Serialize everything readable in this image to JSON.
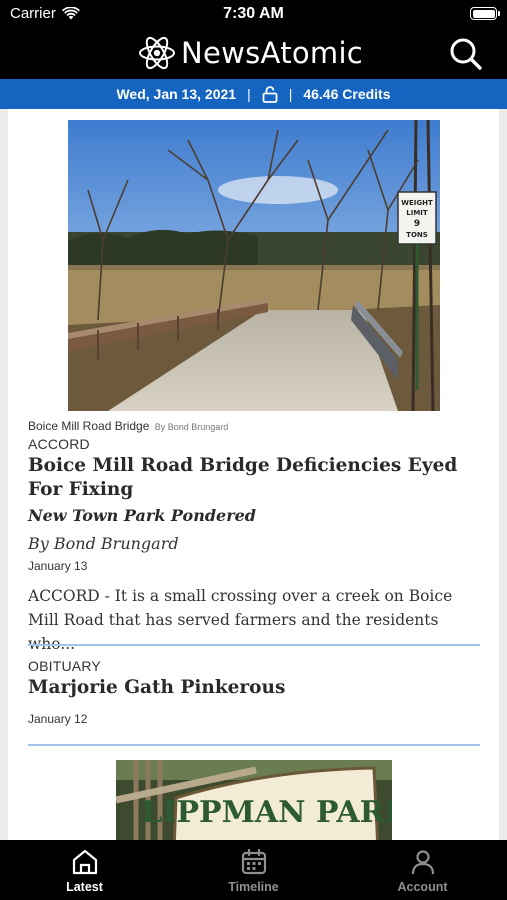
{
  "status_bar": {
    "carrier": "Carrier",
    "time": "7:30 AM",
    "battery_level": 1.0
  },
  "header": {
    "logo_text": "NewsAtomic",
    "search_icon": "search-icon",
    "logo_icon": "atom-icon"
  },
  "info_bar": {
    "date": "Wed, Jan 13, 2021",
    "separator": "|",
    "lock_icon": "unlock-icon",
    "credits": "46.46 Credits"
  },
  "articles": [
    {
      "image_caption": "Boice Mill Road Bridge",
      "image_credit": "By Bond Brungard",
      "section": "ACCORD",
      "headline": "Boice Mill Road Bridge Deficiencies Eyed For Fixing",
      "subheadline": "New Town Park Pondered",
      "byline": "By Bond Brungard",
      "date": "January 13",
      "excerpt": "ACCORD - It is a small crossing over a creek on Boice Mill Road that has served farmers and the residents who...",
      "sign_text": [
        "WEIGHT",
        "LIMIT",
        "9",
        "TONS"
      ]
    },
    {
      "section": "OBITUARY",
      "headline": "Marjorie Gath Pinkerous",
      "date": "January 12",
      "image_sign_text": "LIPPMAN PARK"
    }
  ],
  "tabs": [
    {
      "label": "Latest",
      "icon": "home-icon",
      "active": true
    },
    {
      "label": "Timeline",
      "icon": "calendar-icon",
      "active": false
    },
    {
      "label": "Account",
      "icon": "person-icon",
      "active": false
    }
  ],
  "colors": {
    "accent": "#1565c0",
    "divider": "#9fc6ea",
    "bar_bg": "#000000"
  }
}
